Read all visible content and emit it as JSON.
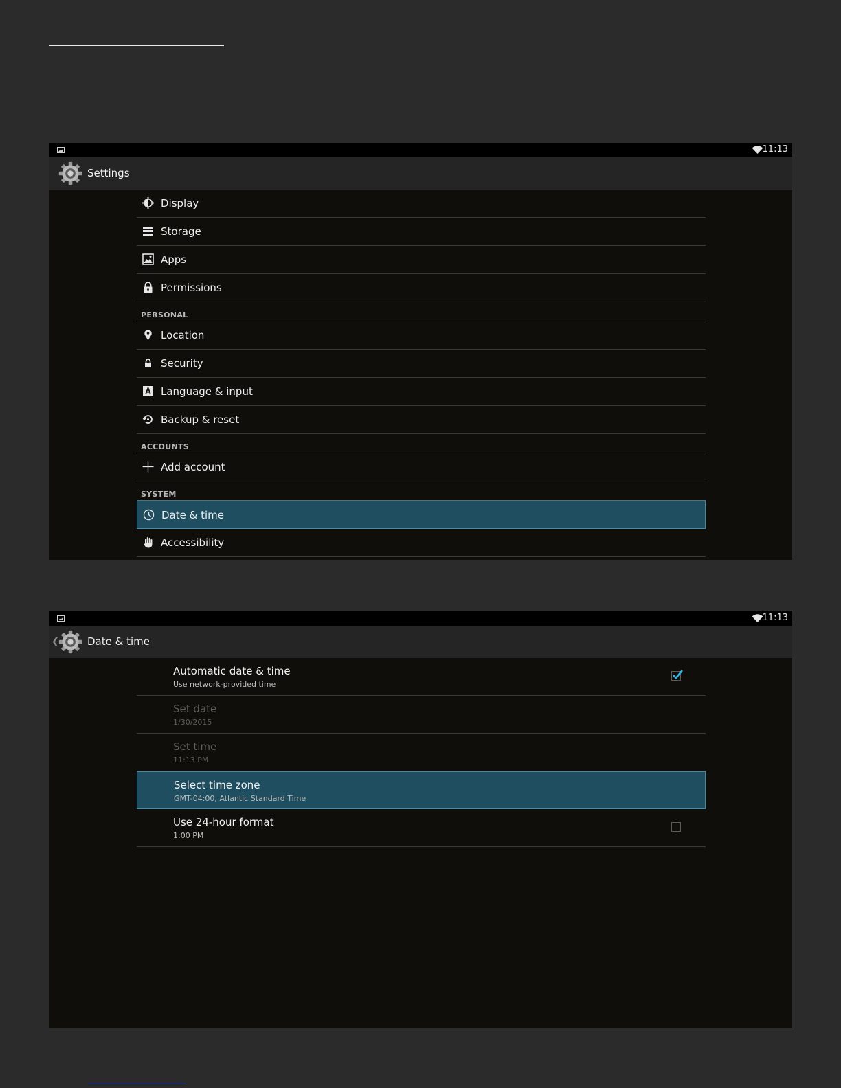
{
  "statusbar": {
    "time": "11:13"
  },
  "screen1": {
    "title": "Settings",
    "items_top": [
      {
        "label": "Display",
        "icon": "brightness-icon"
      },
      {
        "label": "Storage",
        "icon": "storage-icon"
      },
      {
        "label": "Apps",
        "icon": "apps-icon"
      },
      {
        "label": "Permissions",
        "icon": "lock-icon"
      }
    ],
    "personal_header": "PERSONAL",
    "items_personal": [
      {
        "label": "Location",
        "icon": "location-pin-icon"
      },
      {
        "label": "Security",
        "icon": "lock-icon"
      },
      {
        "label": "Language & input",
        "icon": "keyboard-a-icon"
      },
      {
        "label": "Backup & reset",
        "icon": "restore-icon"
      }
    ],
    "accounts_header": "ACCOUNTS",
    "items_accounts": [
      {
        "label": "Add account",
        "icon": "plus-icon"
      }
    ],
    "system_header": "SYSTEM",
    "items_system": [
      {
        "label": "Date & time",
        "icon": "clock-icon",
        "selected": true
      },
      {
        "label": "Accessibility",
        "icon": "hand-icon"
      }
    ]
  },
  "screen2": {
    "title": "Date & time",
    "rows": [
      {
        "title": "Automatic date & time",
        "subtitle": "Use network-provided time",
        "checkbox": true,
        "checked": true
      },
      {
        "title": "Set date",
        "subtitle": "1/30/2015",
        "disabled": true
      },
      {
        "title": "Set time",
        "subtitle": "11:13 PM",
        "disabled": true
      },
      {
        "title": "Select time zone",
        "subtitle": "GMT-04:00, Atlantic Standard Time",
        "selected": true
      },
      {
        "title": "Use 24-hour format",
        "subtitle": "1:00 PM",
        "checkbox": true,
        "checked": false
      }
    ]
  },
  "colors": {
    "accent": "#33b5e5",
    "selected_bg": "#1e4e5f",
    "screen_bg": "#0f0e0a",
    "page_bg": "#2b2b2b"
  }
}
